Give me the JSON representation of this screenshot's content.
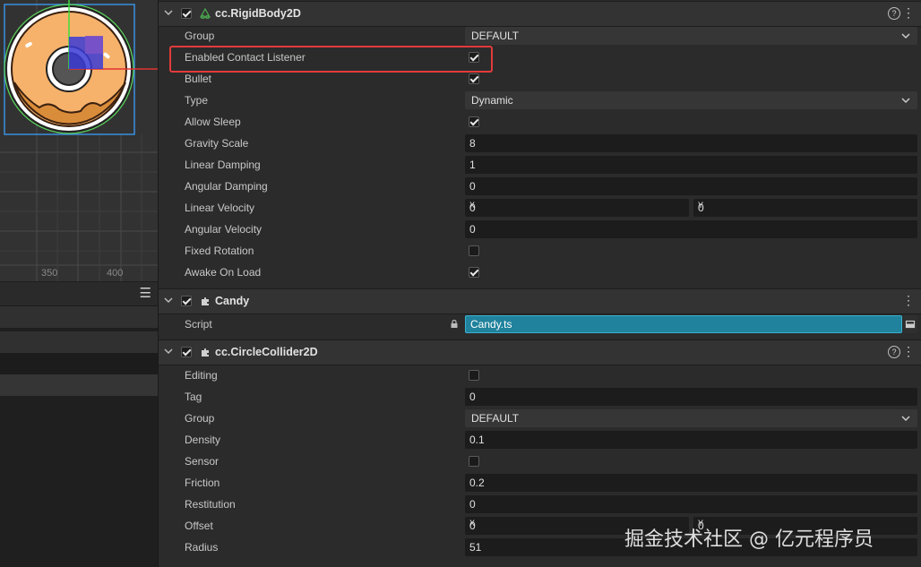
{
  "scene": {
    "ticks": [
      "350",
      "400"
    ]
  },
  "rigidbody": {
    "title": "cc.RigidBody2D",
    "enabled": true,
    "rows": [
      {
        "label": "Group",
        "kind": "select",
        "value": "DEFAULT"
      },
      {
        "label": "Enabled Contact Listener",
        "kind": "check",
        "checked": true
      },
      {
        "label": "Bullet",
        "kind": "check",
        "checked": true
      },
      {
        "label": "Type",
        "kind": "select",
        "value": "Dynamic"
      },
      {
        "label": "Allow Sleep",
        "kind": "check",
        "checked": true
      },
      {
        "label": "Gravity Scale",
        "kind": "number",
        "value": "8"
      },
      {
        "label": "Linear Damping",
        "kind": "number",
        "value": "1"
      },
      {
        "label": "Angular Damping",
        "kind": "number",
        "value": "0"
      },
      {
        "label": "Linear Velocity",
        "kind": "vec2",
        "x": "0",
        "y": "0"
      },
      {
        "label": "Angular Velocity",
        "kind": "number",
        "value": "0"
      },
      {
        "label": "Fixed Rotation",
        "kind": "check",
        "checked": false
      },
      {
        "label": "Awake On Load",
        "kind": "check",
        "checked": true
      }
    ]
  },
  "candy": {
    "title": "Candy",
    "enabled": true,
    "script_label": "Script",
    "script_value": "Candy.ts"
  },
  "collider": {
    "title": "cc.CircleCollider2D",
    "enabled": true,
    "rows": [
      {
        "label": "Editing",
        "kind": "check",
        "checked": false
      },
      {
        "label": "Tag",
        "kind": "number",
        "value": "0"
      },
      {
        "label": "Group",
        "kind": "select",
        "value": "DEFAULT"
      },
      {
        "label": "Density",
        "kind": "number",
        "value": "0.1"
      },
      {
        "label": "Sensor",
        "kind": "check",
        "checked": false
      },
      {
        "label": "Friction",
        "kind": "number",
        "value": "0.2"
      },
      {
        "label": "Restitution",
        "kind": "number",
        "value": "0"
      },
      {
        "label": "Offset",
        "kind": "vec2",
        "x": "0",
        "y": "0"
      },
      {
        "label": "Radius",
        "kind": "number",
        "value": "51"
      }
    ]
  },
  "axis_labels": {
    "x": "X",
    "y": "Y"
  },
  "watermark": "掘金技术社区 @ 亿元程序员",
  "colors": {
    "highlight": "#e23b3b",
    "asset": "#20829c",
    "panel": "#2b2b2b"
  },
  "icons": {
    "collapse": "chevron-down-icon",
    "help": "help-circle-icon",
    "more": "more-vertical-icon",
    "component": "puzzle-icon",
    "lock": "lock-icon"
  }
}
